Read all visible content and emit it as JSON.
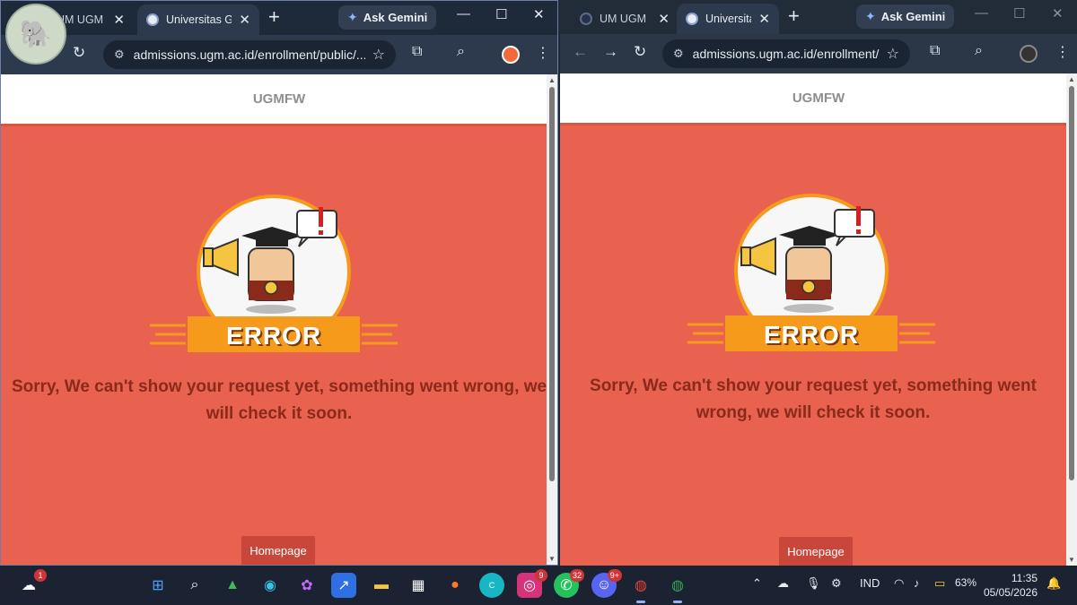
{
  "left_window": {
    "tabs": [
      {
        "label": "UM UGM Com",
        "active": false
      },
      {
        "label": "Universitas Ga",
        "active": true
      }
    ],
    "ask_gemini": "Ask Gemini",
    "url": "admissions.ugm.ac.id/enrollment/public/...",
    "site_header": "UGMFW",
    "error_badge": "ERROR",
    "error_message": "Sorry, We can't show your request yet, something went wrong, we will check it soon.",
    "homepage_button": "Homepage"
  },
  "right_window": {
    "tabs": [
      {
        "label": "UM UGM",
        "active": false
      },
      {
        "label": "Universitas",
        "active": true
      }
    ],
    "ask_gemini": "Ask Gemini",
    "url": "admissions.ugm.ac.id/enrollment/...",
    "site_header": "UGMFW",
    "error_badge": "ERROR",
    "error_message": "Sorry, We can't show your request yet, something went wrong, we will check it soon.",
    "homepage_button": "Homepage"
  },
  "taskbar": {
    "weather_badge": "1",
    "instagram_badge": "9",
    "whatsapp_badge": "32",
    "discord_badge": "9+",
    "language": "IND",
    "battery": "63%",
    "time": "11:35",
    "date": "05/05/2026",
    "apps": [
      "windows-start",
      "search",
      "google-drive",
      "edge",
      "copilot",
      "vector-app",
      "file-explorer",
      "microsoft-store",
      "firefox",
      "canva",
      "instagram",
      "whatsapp",
      "discord",
      "chrome",
      "chrome-profile"
    ]
  },
  "colors": {
    "page_background": "#e8624f",
    "message_text": "#8a2a1a",
    "homepage_button": "#c9463a",
    "browser_chrome": "#2d3a4d"
  }
}
